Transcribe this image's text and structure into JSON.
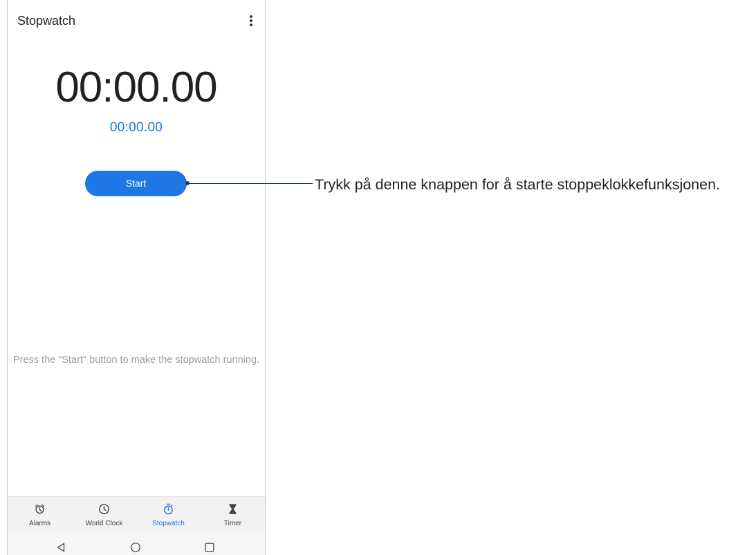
{
  "app": {
    "title": "Stopwatch",
    "menu_icon": "more-vert-icon"
  },
  "stopwatch": {
    "elapsed_time": "00:00.00",
    "lap_time": "00:00.00",
    "start_button_label": "Start",
    "hint": "Press the \"Start\" button to make the stopwatch running."
  },
  "bottom_nav": {
    "items": [
      {
        "label": "Alarms",
        "icon": "alarm-icon",
        "active": false
      },
      {
        "label": "World Clock",
        "icon": "world-clock-icon",
        "active": false
      },
      {
        "label": "Stopwatch",
        "icon": "stopwatch-icon",
        "active": true
      },
      {
        "label": "Timer",
        "icon": "hourglass-icon",
        "active": false
      }
    ]
  },
  "system_nav": {
    "back_icon": "back-icon",
    "home_icon": "home-icon",
    "recents_icon": "recents-icon"
  },
  "annotation": {
    "text": "Trykk på denne knappen for å starte stoppeklokkefunksjonen."
  },
  "colors": {
    "accent": "#1a73e8",
    "start_button": "#1e77e4",
    "primary_text": "#212121",
    "secondary_text": "#9e9e9e",
    "annotation_line": "#1f3a66",
    "annotation_text": "#231f20"
  }
}
